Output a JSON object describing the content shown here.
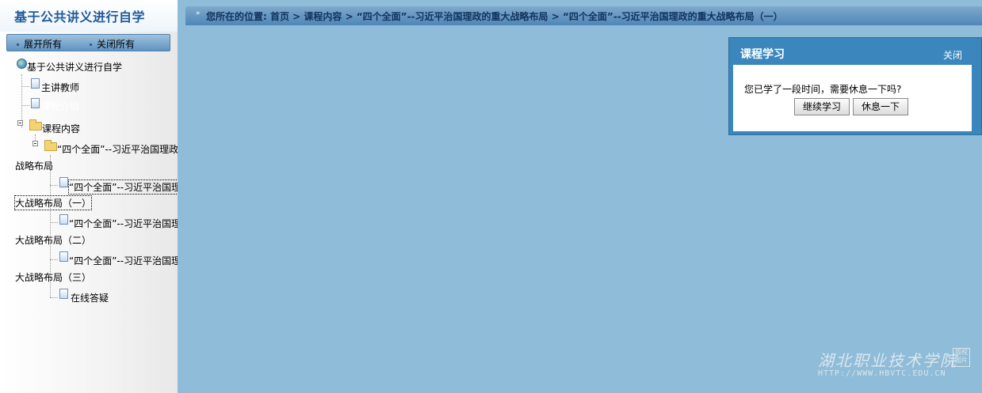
{
  "sidebar": {
    "title": "基于公共讲义进行自学",
    "expand_all": "展开所有",
    "collapse_all": "关闭所有",
    "tree": {
      "root": "基于公共讲义进行自学",
      "teacher": "主讲教师",
      "course_info": "课程介绍",
      "course_content": "课程内容",
      "chapter_line1": "“四个全面”--习近平治国理政",
      "chapter_line2": "战略布局",
      "lesson1_line1": "“四个全面”--习近平治国理",
      "lesson1_line2": "大战略布局（一）",
      "lesson2_line1": "“四个全面”--习近平治国理",
      "lesson2_line2": "大战略布局（二）",
      "lesson3_line1": "“四个全面”--习近平治国理",
      "lesson3_line2": "大战略布局（三）",
      "qa": "在线答疑"
    }
  },
  "breadcrumb": {
    "text": "您所在的位置: 首页 > 课程内容 > “四个全面”--习近平治国理政的重大战略布局 > “四个全面”--习近平治国理政的重大战略布局（一）"
  },
  "dialog": {
    "title": "课程学习",
    "close_label": "关闭",
    "message": "您已学了一段时间，需要休息一下吗?",
    "continue_label": "继续学习",
    "rest_label": "休息一下"
  },
  "watermark": {
    "name": "湖北职业技术学院",
    "stamp": "版权 图片",
    "url": "HTTP://WWW.HBVTC.EDU.CN"
  },
  "colors": {
    "background": "#8fbcd8",
    "title_blue": "#1e5a9c",
    "dialog_blue": "#3a86bd"
  }
}
